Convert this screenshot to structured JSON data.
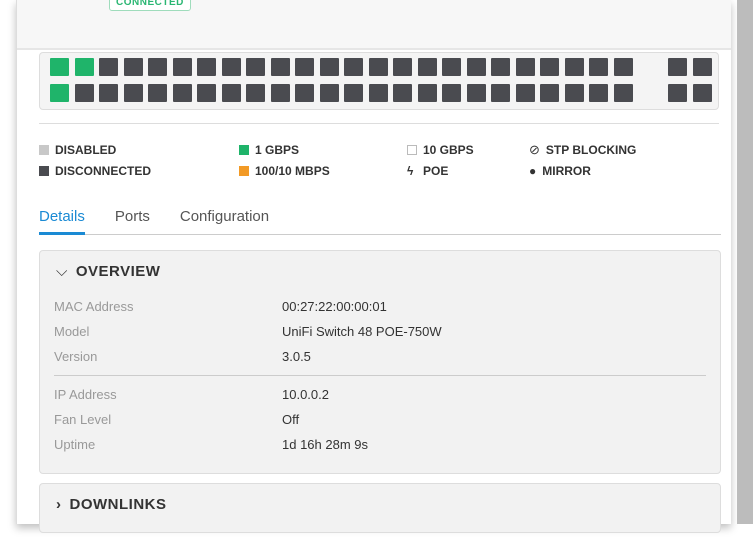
{
  "status_badge": "CONNECTED",
  "ports": {
    "row1": [
      "g",
      "g",
      "d",
      "d",
      "d",
      "d",
      "d",
      "d",
      "d",
      "d",
      "d",
      "d",
      "d",
      "d",
      "d",
      "d",
      "d",
      "d",
      "d",
      "d",
      "d",
      "d",
      "d",
      "d"
    ],
    "row2": [
      "g",
      "d",
      "d",
      "d",
      "d",
      "d",
      "d",
      "d",
      "d",
      "d",
      "d",
      "d",
      "d",
      "d",
      "d",
      "d",
      "d",
      "d",
      "d",
      "d",
      "d",
      "d",
      "d",
      "d"
    ],
    "sfp1": [
      "d",
      "d"
    ],
    "sfp2": [
      "d",
      "d"
    ]
  },
  "legend": {
    "disabled": "DISABLED",
    "disconnected": "DISCONNECTED",
    "gbps1": "1 GBPS",
    "mbps": "100/10 MBPS",
    "gbps10": "10 GBPS",
    "poe": "POE",
    "stp": "STP BLOCKING",
    "mirror": "MIRROR"
  },
  "colors": {
    "green": "#1fb46a",
    "orange": "#f29a26",
    "dark": "#4a4b50",
    "disabled": "#c8c8c8",
    "accent": "#1a8ad4"
  },
  "tabs": [
    "Details",
    "Ports",
    "Configuration"
  ],
  "overview": {
    "title": "OVERVIEW",
    "group1": [
      {
        "k": "MAC Address",
        "v": "00:27:22:00:00:01"
      },
      {
        "k": "Model",
        "v": "UniFi Switch 48 POE-750W"
      },
      {
        "k": "Version",
        "v": "3.0.5"
      }
    ],
    "group2": [
      {
        "k": "IP Address",
        "v": "10.0.0.2"
      },
      {
        "k": "Fan Level",
        "v": "Off"
      },
      {
        "k": "Uptime",
        "v": "1d 16h 28m 9s"
      }
    ]
  },
  "downlinks": {
    "title": "DOWNLINKS"
  }
}
